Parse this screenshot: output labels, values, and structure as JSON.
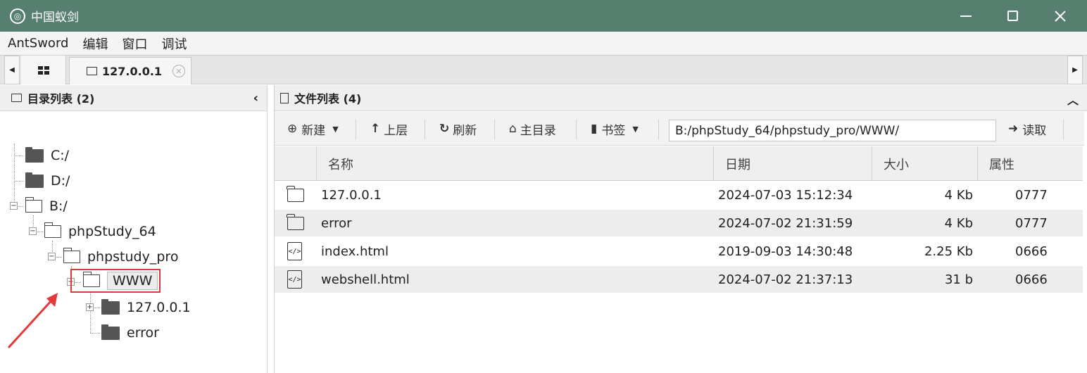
{
  "window": {
    "title": "中国蚁剑"
  },
  "menu": [
    "AntSword",
    "编辑",
    "窗口",
    "调试"
  ],
  "tabs": {
    "active_label": "127.0.0.1"
  },
  "left_panel": {
    "title": "目录列表 (2)",
    "tree": {
      "c_drive": "C:/",
      "d_drive": "D:/",
      "b_drive": "B:/",
      "phpstudy64": "phpStudy_64",
      "phpstudy_pro": "phpstudy_pro",
      "www": "WWW",
      "host_folder": "127.0.0.1",
      "error_folder": "error"
    }
  },
  "right_panel": {
    "title": "文件列表 (4)",
    "toolbar": {
      "new_label": "新建",
      "up_label": "上层",
      "refresh_label": "刷新",
      "home_label": "主目录",
      "bookmark_label": "书签",
      "path_value": "B:/phpStudy_64/phpstudy_pro/WWW/",
      "read_label": "读取"
    },
    "columns": {
      "name": "名称",
      "date": "日期",
      "size": "大小",
      "attr": "属性"
    },
    "rows": [
      {
        "icon": "folder-icon",
        "name": "127.0.0.1",
        "date": "2024-07-03 15:12:34",
        "size": "4 Kb",
        "attr": "0777"
      },
      {
        "icon": "folder-icon",
        "name": "error",
        "date": "2024-07-02 21:31:59",
        "size": "4 Kb",
        "attr": "0777"
      },
      {
        "icon": "code-file-icon",
        "name": "index.html",
        "date": "2019-09-03 14:30:48",
        "size": "2.25 Kb",
        "attr": "0666"
      },
      {
        "icon": "code-file-icon",
        "name": "webshell.html",
        "date": "2024-07-02 21:37:13",
        "size": "31 b",
        "attr": "0666"
      }
    ]
  },
  "colors": {
    "titlebar": "#567f70",
    "highlight_box": "#d93b3b",
    "annotation_arrow": "#e03a3a"
  }
}
